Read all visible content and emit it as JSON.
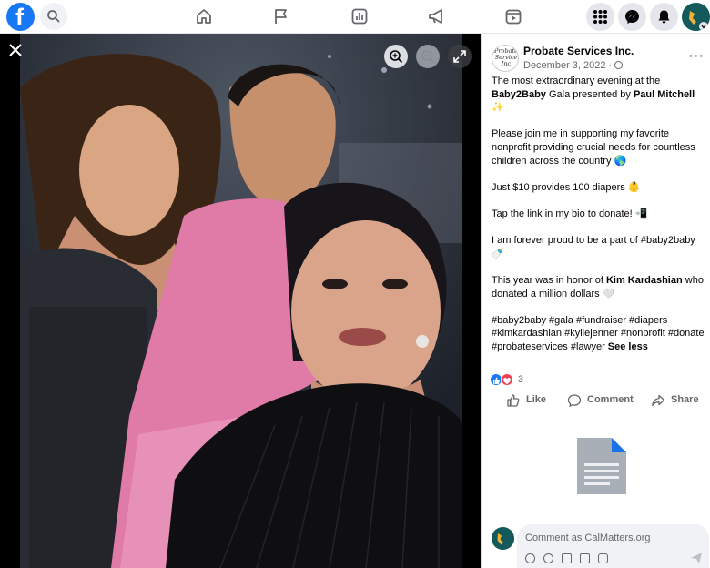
{
  "topbar": {
    "logo": "facebook-logo",
    "logo_letter": "f",
    "nav_icons": [
      "home-icon",
      "pages-flag-icon",
      "ads-manager-icon",
      "megaphone-icon",
      "watch-icon"
    ],
    "right_icons": [
      "menu-grid-icon",
      "messenger-icon",
      "notifications-icon",
      "account-avatar"
    ]
  },
  "photo": {
    "controls": [
      "close-icon",
      "zoom-in-icon",
      "zoom-out-icon",
      "fullscreen-icon"
    ]
  },
  "post": {
    "page_name": "Probate Services Inc.",
    "avatar_text": "Probate Service Inc",
    "date": "December 3, 2022 ·",
    "paragraphs": {
      "p1_pre": "The most extraordinary evening at the ",
      "p1_bold1": "Baby2Baby",
      "p1_mid": " Gala presented by ",
      "p1_bold2": "Paul Mitchell",
      "p1_emoji": " ✨",
      "p2": "Please join me in supporting my favorite nonprofit providing crucial needs for countless children across the country 🌎",
      "p3": "Just $10 provides 100 diapers 👶",
      "p4": "Tap the link in my bio to donate! 📲",
      "p5": "I am forever proud to be a part of #baby2baby 🍼",
      "p6_pre": "This year was in honor of ",
      "p6_bold": "Kim Kardashian",
      "p6_post": " who donated a million dollars 🤍",
      "p7": "#baby2baby #gala #fundraiser #diapers #kimkardashian #kyliejenner #nonprofit #donate #probateservices #lawyer ",
      "see_less": "See less"
    },
    "reactions": {
      "types": [
        "like",
        "love"
      ],
      "count": "3",
      "like_color": "#1877f2",
      "love_color": "#f33e58"
    },
    "actions": {
      "like": "Like",
      "comment": "Comment",
      "share": "Share"
    },
    "comment": {
      "placeholder": "Comment as CalMatters.org",
      "tools": [
        "avatar-sticker-icon",
        "emoji-icon",
        "camera-icon",
        "gif-icon",
        "sticker-icon"
      ]
    }
  },
  "colors": {
    "brand": "#1877f2",
    "secondary_text": "#65676b",
    "panel_bg": "#000000"
  }
}
